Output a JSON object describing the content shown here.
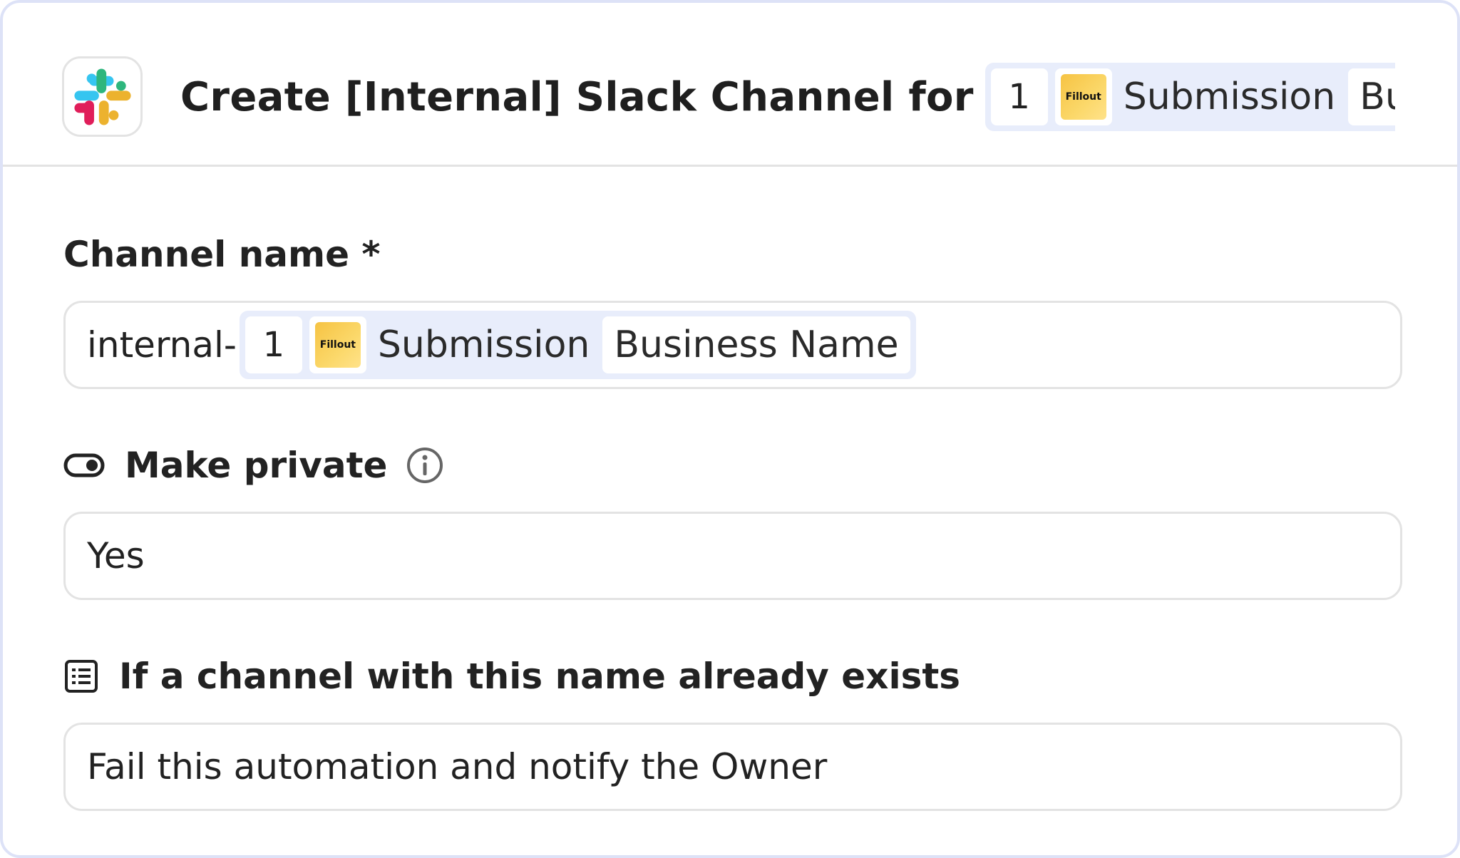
{
  "header": {
    "app_icon": "slack-logo",
    "title": "Create [Internal] Slack Channel for",
    "title_chips": {
      "step_number": "1",
      "app_badge": "Fillout",
      "source_label": "Submission",
      "field_label": "Busine"
    }
  },
  "channel_name": {
    "label": "Channel name *",
    "prefix": "internal-",
    "chips": {
      "step_number": "1",
      "app_badge": "Fillout",
      "source_label": "Submission",
      "field_label": "Business Name"
    }
  },
  "make_private": {
    "icon": "toggle-icon",
    "label": "Make private",
    "info_icon": "info-icon",
    "value": "Yes"
  },
  "if_exists": {
    "icon": "list-icon",
    "label": "If a channel with this name already exists",
    "value": "Fail this automation and notify the Owner"
  }
}
